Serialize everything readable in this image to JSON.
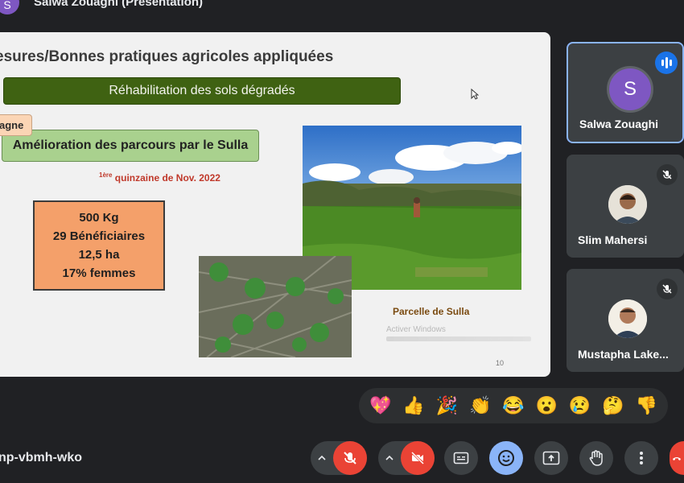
{
  "header": {
    "presenter_initial": "S",
    "title": "Salwa Zouaghi (Présentation)"
  },
  "slide": {
    "title": "esures/Bonnes pratiques agricoles appliquées",
    "banner": "Réhabilitation des sols dégradés",
    "tag": "agne",
    "subtitle": "Amélioration des parcours par le Sulla",
    "date_sup": "1ère",
    "date_text": " quinzaine de Nov. 2022",
    "stats": [
      "500 Kg",
      "29 Bénéficiaires",
      "12,5 ha",
      "17% femmes"
    ],
    "caption": "Parcelle de Sulla",
    "watermark": "Activer Windows",
    "page_number": "10"
  },
  "participants": [
    {
      "name": "Salwa Zouaghi",
      "initial": "S",
      "status": "speaking"
    },
    {
      "name": "Slim Mahersi",
      "status": "muted"
    },
    {
      "name": "Mustapha Lake...",
      "status": "muted"
    }
  ],
  "reactions": [
    "💖",
    "👍",
    "🎉",
    "👏",
    "😂",
    "😮",
    "😢",
    "🤔",
    "👎"
  ],
  "meeting": {
    "code": "np-vbmh-wko"
  },
  "colors": {
    "danger": "#ea4335",
    "accent": "#8ab4f8",
    "panel": "#3c4043",
    "background": "#202124"
  }
}
